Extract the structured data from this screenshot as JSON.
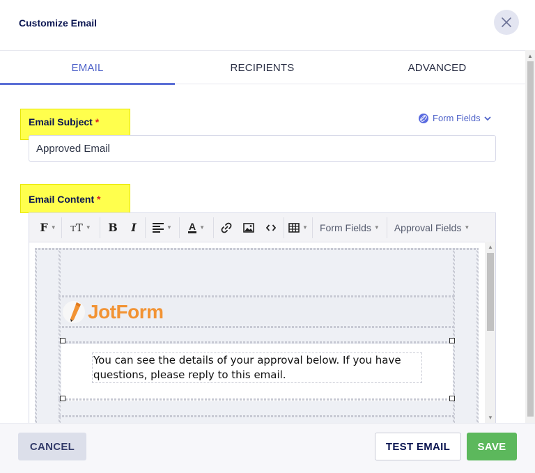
{
  "dialog": {
    "title": "Customize Email"
  },
  "tabs": [
    {
      "label": "EMAIL",
      "active": true
    },
    {
      "label": "RECIPIENTS",
      "active": false
    },
    {
      "label": "ADVANCED",
      "active": false
    }
  ],
  "subject": {
    "label": "Email Subject",
    "required_mark": "*",
    "value": "Approved Email",
    "form_fields_link": "Form Fields"
  },
  "content": {
    "label": "Email Content",
    "required_mark": "*"
  },
  "toolbar": {
    "form_fields": "Form Fields",
    "approval_fields": "Approval Fields",
    "icons": [
      "font-family-icon",
      "font-size-icon",
      "bold-icon",
      "italic-icon",
      "align-icon",
      "text-color-icon",
      "link-icon",
      "image-icon",
      "code-icon",
      "table-icon"
    ]
  },
  "email_body": {
    "logo_text": "JotForm",
    "message": "You can see the details of your approval below. If you have questions, please reply to this email."
  },
  "footer": {
    "cancel": "CANCEL",
    "test_email": "TEST EMAIL",
    "save": "SAVE"
  },
  "colors": {
    "accent": "#4f63c9",
    "save": "#5cb85c",
    "highlight": "#ffff4d",
    "logo": "#f29333"
  }
}
